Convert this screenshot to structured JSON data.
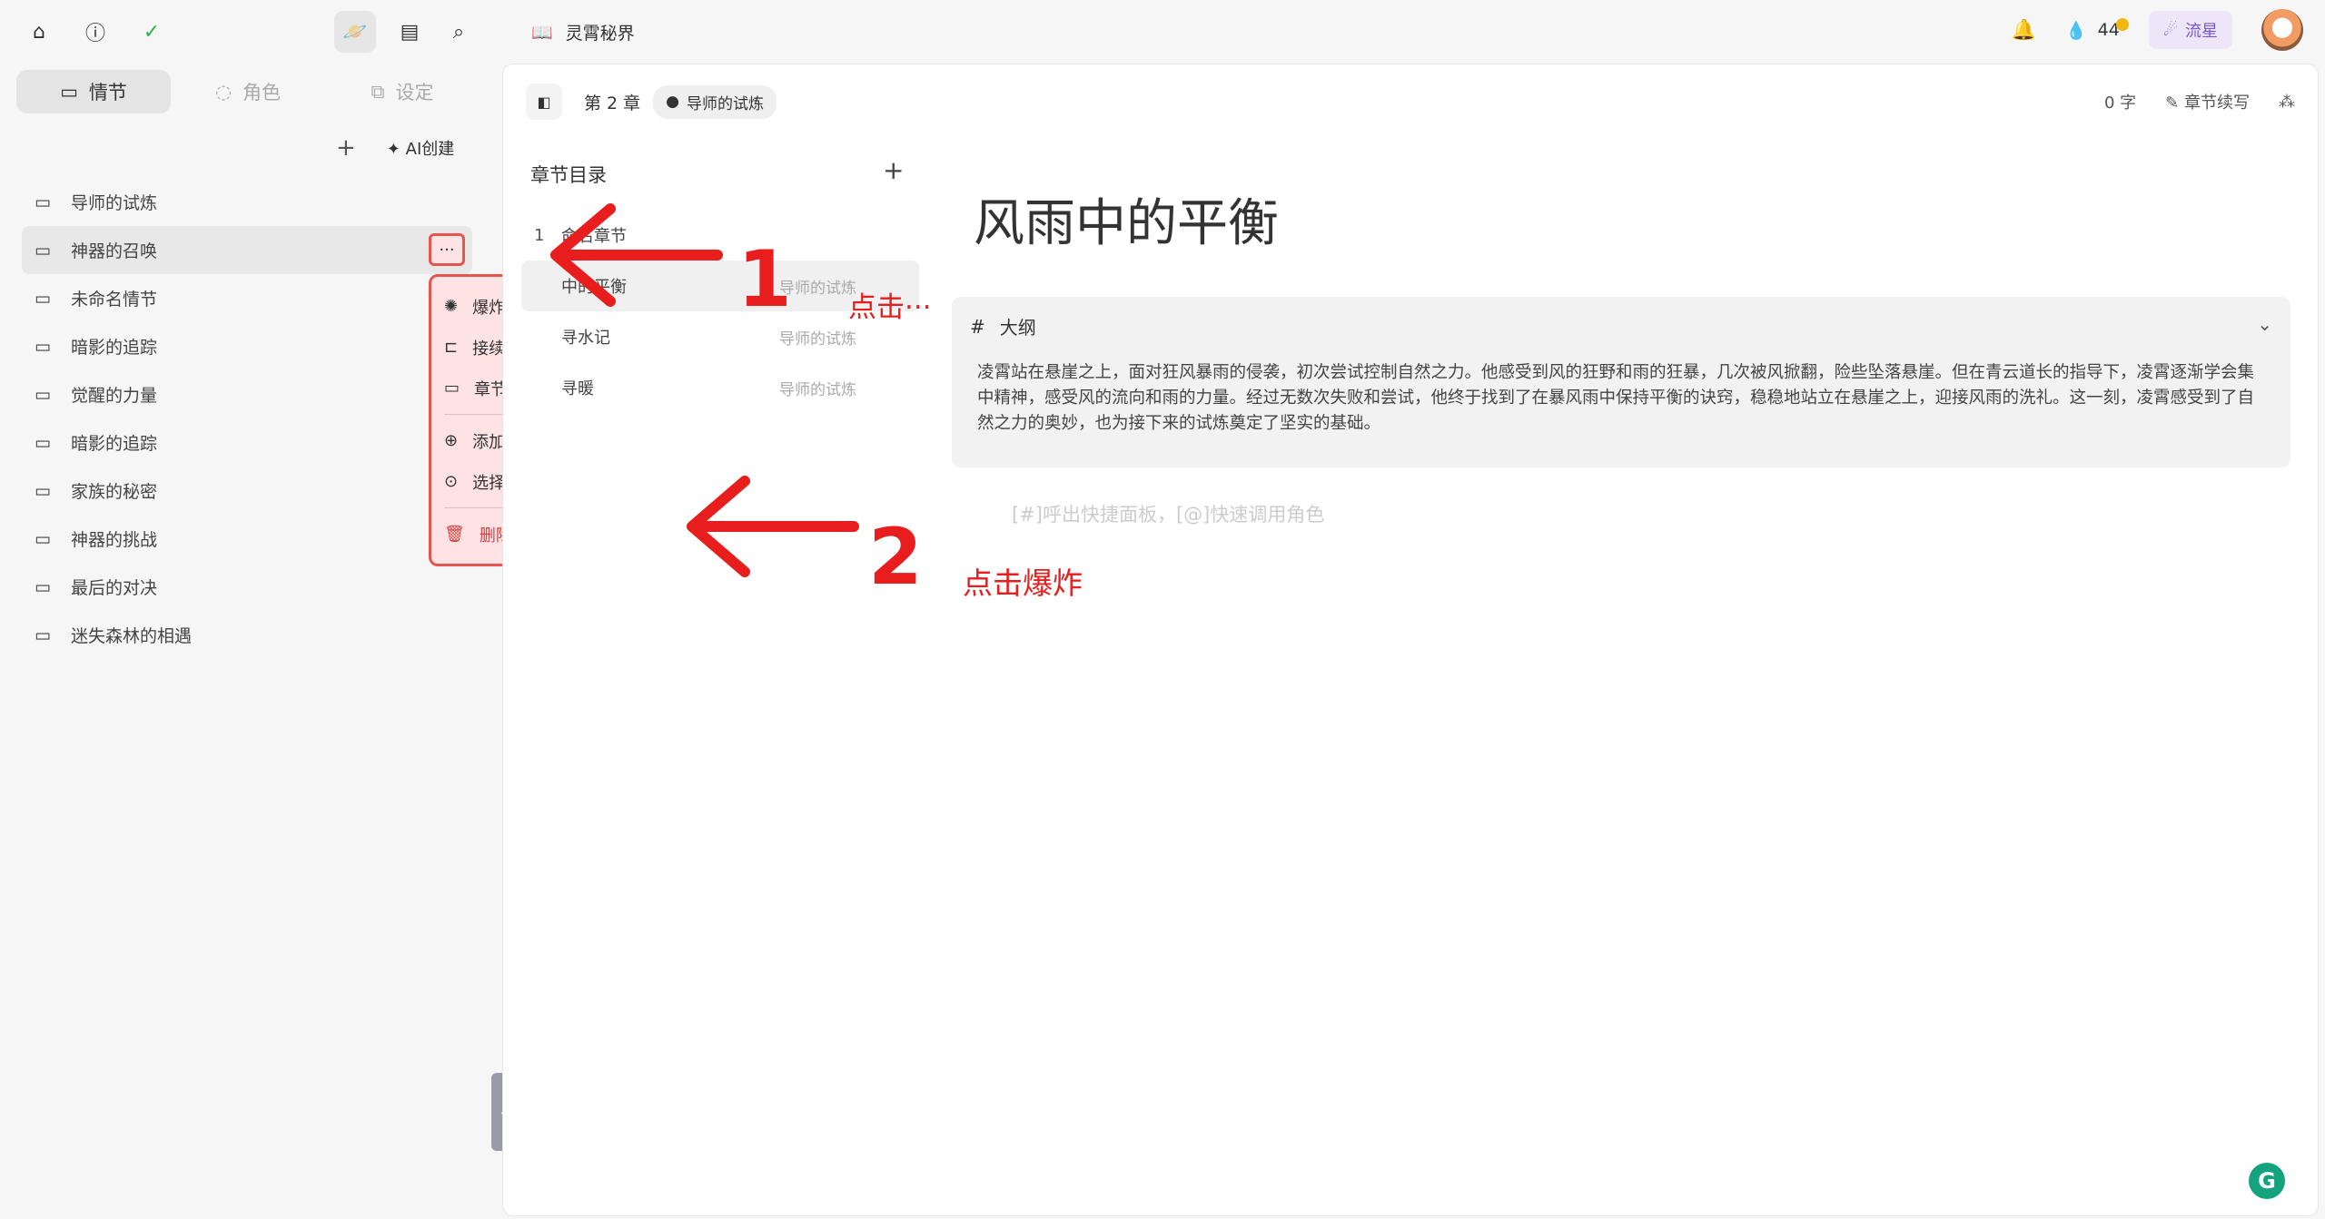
{
  "sidebar": {
    "tabs": [
      {
        "label": "情节",
        "icon": "plot-icon"
      },
      {
        "label": "角色",
        "icon": "character-icon"
      },
      {
        "label": "设定",
        "icon": "settings-icon"
      }
    ],
    "ai_create_label": "AI创建",
    "plots": [
      {
        "label": "导师的试炼"
      },
      {
        "label": "神器的召唤"
      },
      {
        "label": "未命名情节"
      },
      {
        "label": "暗影的追踪"
      },
      {
        "label": "觉醒的力量"
      },
      {
        "label": "暗影的追踪"
      },
      {
        "label": "家族的秘密"
      },
      {
        "label": "神器的挑战"
      },
      {
        "label": "最后的对决"
      },
      {
        "label": "迷失森林的相遇"
      }
    ],
    "more_label": "···",
    "context_menu": {
      "items": [
        {
          "label": "爆炸",
          "icon": "explode-icon"
        },
        {
          "label": "接续",
          "icon": "continue-icon"
        },
        {
          "label": "章节化",
          "icon": "chapterize-icon"
        },
        {
          "label": "添加子情节",
          "icon": "add-subplot-icon"
        },
        {
          "label": "选择",
          "icon": "select-icon"
        },
        {
          "label": "删除",
          "icon": "trash-icon"
        }
      ]
    }
  },
  "header": {
    "book_title": "灵霄秘界",
    "coins": "44",
    "liuxing_label": "流星"
  },
  "editor": {
    "chapter_label": "第 2 章",
    "plot_pill": "导师的试炼",
    "word_count": "0 字",
    "continue_label": "章节续写",
    "toc_title": "章节目录",
    "toc": [
      {
        "num": "1",
        "name": "命名章节",
        "tag": ""
      },
      {
        "num": "",
        "name": "中的平衡",
        "tag": "导师的试炼"
      },
      {
        "num": "",
        "name": "寻水记",
        "tag": "导师的试炼"
      },
      {
        "num": "",
        "name": "寻暖",
        "tag": "导师的试炼"
      }
    ],
    "chapter_title": "风雨中的平衡",
    "outline_label": "大纲",
    "outline_text": "凌霄站在悬崖之上，面对狂风暴雨的侵袭，初次尝试控制自然之力。他感受到风的狂野和雨的狂暴，几次被风掀翻，险些坠落悬崖。但在青云道长的指导下，凌霄逐渐学会集中精神，感受风的流向和雨的力量。经过无数次失败和尝试，他终于找到了在暴风雨中保持平衡的诀窍，稳稳地站立在悬崖之上，迎接风雨的洗礼。这一刻，凌霄感受到了自然之力的奥妙，也为接下来的试炼奠定了坚实的基础。",
    "placeholder": "[#]呼出快捷面板，[@]快速调用角色"
  },
  "annotations": {
    "step1_number": "1",
    "step1_text": "点击···",
    "step2_number": "2",
    "step2_text": "点击爆炸"
  }
}
